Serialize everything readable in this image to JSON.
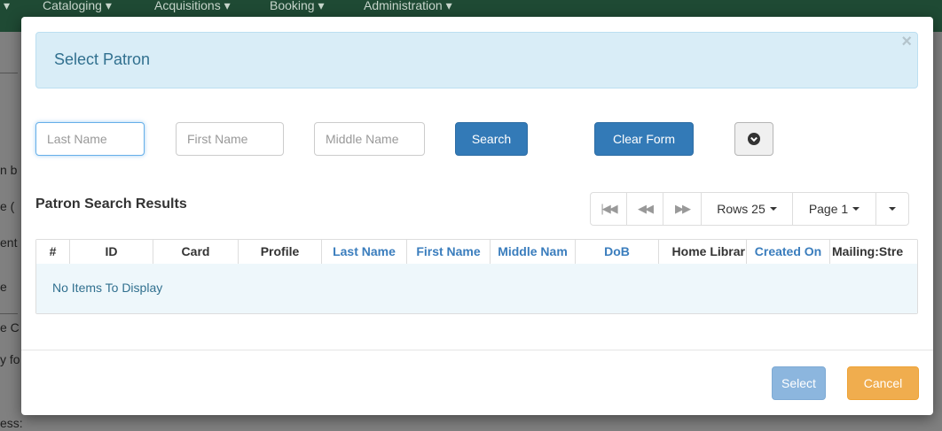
{
  "background": {
    "nav_items": [
      {
        "label": "Cataloging ▾"
      },
      {
        "label": "Acquisitions ▾"
      },
      {
        "label": "Booking ▾"
      },
      {
        "label": "Administration ▾"
      }
    ],
    "nav_left_caret": "▾",
    "fragments": [
      "n b",
      "e (",
      "ent",
      "e",
      "e C",
      "y fo",
      "ess:"
    ]
  },
  "modal": {
    "title": "Select Patron",
    "close_glyph": "×"
  },
  "search": {
    "last_name": {
      "placeholder": "Last Name",
      "value": ""
    },
    "first_name": {
      "placeholder": "First Name",
      "value": ""
    },
    "middle_name": {
      "placeholder": "Middle Name",
      "value": ""
    },
    "search_label": "Search",
    "clear_label": "Clear Form",
    "toggle_icon": "chevron-circle-down-icon"
  },
  "results": {
    "title": "Patron Search Results",
    "pager": {
      "first_icon": "first-page-icon",
      "prev_icon": "previous-page-icon",
      "next_icon": "next-page-icon",
      "rows_label": "Rows 25",
      "page_label": "Page 1"
    },
    "columns": [
      {
        "label": "#",
        "sortable": false
      },
      {
        "label": "ID",
        "sortable": false
      },
      {
        "label": "Card",
        "sortable": false
      },
      {
        "label": "Profile",
        "sortable": false
      },
      {
        "label": "Last Name",
        "sortable": true
      },
      {
        "label": "First Name",
        "sortable": true
      },
      {
        "label": "Middle Nam",
        "sortable": true
      },
      {
        "label": "DoB",
        "sortable": true
      },
      {
        "label": "Home Librar",
        "sortable": false
      },
      {
        "label": "Created On",
        "sortable": true
      },
      {
        "label": "Mailing:Stre",
        "sortable": false
      }
    ],
    "empty_message": "No Items To Display"
  },
  "footer": {
    "select_label": "Select",
    "cancel_label": "Cancel"
  },
  "colors": {
    "header_bg": "#d9edf7",
    "title_text": "#31708f",
    "primary": "#337ab7",
    "cancel": "#f0ad4e",
    "navbar": "#1f4a34"
  }
}
